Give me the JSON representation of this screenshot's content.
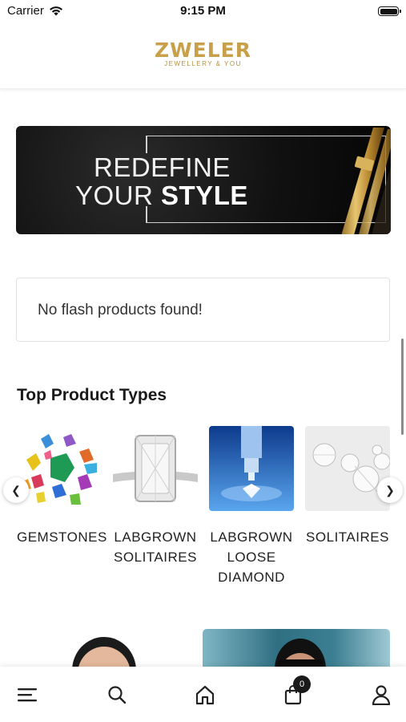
{
  "status_bar": {
    "carrier": "Carrier",
    "time": "9:15 PM"
  },
  "header": {
    "logo_text": "ZWELER",
    "logo_tagline": "JEWELLERY & YOU"
  },
  "banner": {
    "line1": "REDEFINE",
    "line2_regular": "YOUR",
    "line2_bold": "STYLE"
  },
  "flash": {
    "message": "No flash products found!"
  },
  "top_product_types": {
    "title": "Top Product Types",
    "items": [
      {
        "label": "GEMSTONES"
      },
      {
        "label": "LABGROWN\nSOLITAIRES"
      },
      {
        "label": "LABGROWN\nLOOSE\nDIAMOND"
      },
      {
        "label": "SOLITAIRES"
      }
    ]
  },
  "bottom_nav": {
    "cart_count": "0"
  },
  "colors": {
    "brand_gold": "#c9a04a",
    "text_dark": "#1a1a1a"
  }
}
